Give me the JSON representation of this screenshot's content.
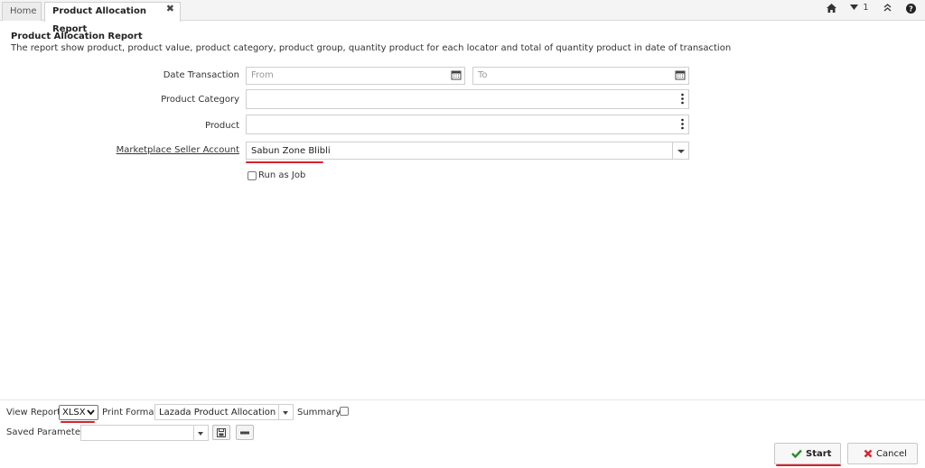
{
  "tabs": [
    {
      "label": "Home"
    },
    {
      "label": "Product Allocation Report"
    }
  ],
  "tabbar_right": {
    "window_count": "1"
  },
  "header": {
    "title": "Product Allocation Report",
    "description": "The report show product, product value, product category, product group, quantity product for each locator and total of quantity product in date of transaction"
  },
  "form": {
    "date_transaction": {
      "label": "Date Transaction",
      "from_placeholder": "From",
      "to_placeholder": "To"
    },
    "product_category": {
      "label": "Product Category",
      "value": ""
    },
    "product": {
      "label": "Product",
      "value": ""
    },
    "marketplace_seller_account": {
      "label": "Marketplace Seller Account",
      "value": "Sabun Zone Blibli"
    },
    "run_as_job": {
      "label": "Run as Job",
      "checked": false
    }
  },
  "footer": {
    "view_report_label": "View Report",
    "view_report_value": "XLSX",
    "print_format_label": "Print Format",
    "print_format_value": "Lazada Product Allocation Re",
    "summary_label": "Summary",
    "summary_checked": false,
    "saved_parameters_label": "Saved Parameters",
    "saved_parameters_value": ""
  },
  "actions": {
    "start_label": "Start",
    "cancel_label": "Cancel"
  },
  "colors": {
    "accent_red": "#d9232d",
    "start_check": "#2e8b2e",
    "cancel_x": "#d9232d"
  }
}
